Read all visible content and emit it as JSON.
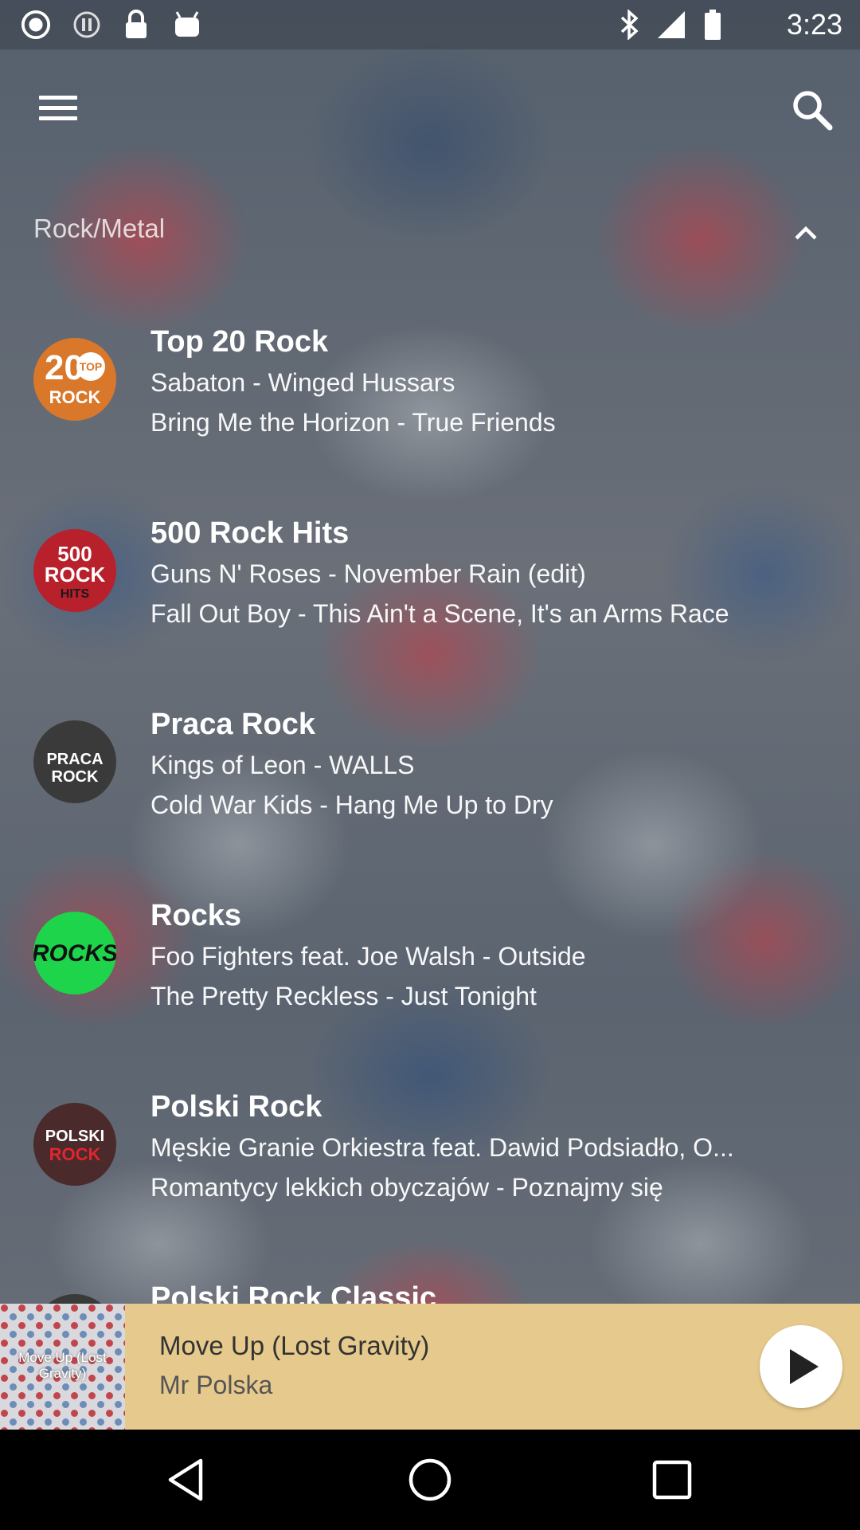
{
  "status_bar": {
    "time": "3:23",
    "icons": [
      "app-notification-icon",
      "app-notification-icon",
      "lock-icon",
      "android-icon",
      "bluetooth-icon",
      "signal-icon",
      "battery-icon"
    ]
  },
  "section": {
    "title": "Rock/Metal",
    "expanded": true
  },
  "stations": [
    {
      "name": "Top 20 Rock",
      "line1": "Sabaton - Winged Hussars",
      "line2": "Bring Me the Horizon - True Friends",
      "logo_top": "20",
      "logo_mid": "TOP",
      "logo_bottom": "ROCK",
      "logo_color": "#d9782b"
    },
    {
      "name": "500 Rock Hits",
      "line1": "Guns N' Roses - November Rain (edit)",
      "line2": "Fall Out Boy - This Ain't a Scene, It's an Arms Race",
      "logo_top": "500",
      "logo_mid": "ROCK",
      "logo_bottom": "HITS",
      "logo_color": "#b8202c"
    },
    {
      "name": "Praca Rock",
      "line1": "Kings of Leon - WALLS",
      "line2": "Cold War Kids - Hang Me Up to Dry",
      "logo_top": "PRACA",
      "logo_mid": "",
      "logo_bottom": "ROCK",
      "logo_color": "#3a3a3a"
    },
    {
      "name": "Rocks",
      "line1": "Foo Fighters feat. Joe Walsh - Outside",
      "line2": "The Pretty Reckless - Just Tonight",
      "logo_top": "ROCKS",
      "logo_mid": "",
      "logo_bottom": "",
      "logo_color": "#1ed44a"
    },
    {
      "name": "Polski Rock",
      "line1": "Męskie Granie Orkiestra feat. Dawid Podsiadło, O...",
      "line2": "Romantycy lekkich obyczajów - Poznajmy się",
      "logo_top": "POLSKI",
      "logo_mid": "",
      "logo_bottom": "ROCK",
      "logo_color": "#4a2a2a"
    },
    {
      "name": "Polski Rock Classic",
      "line1": "",
      "line2": "",
      "logo_top": "",
      "logo_mid": "",
      "logo_bottom": "",
      "logo_color": "#3a3a3a"
    }
  ],
  "player": {
    "title": "Move Up (Lost Gravity)",
    "artist": "Mr Polska",
    "art_text": "Move Up (Lost Gravity)",
    "background": "#e6c98c"
  }
}
